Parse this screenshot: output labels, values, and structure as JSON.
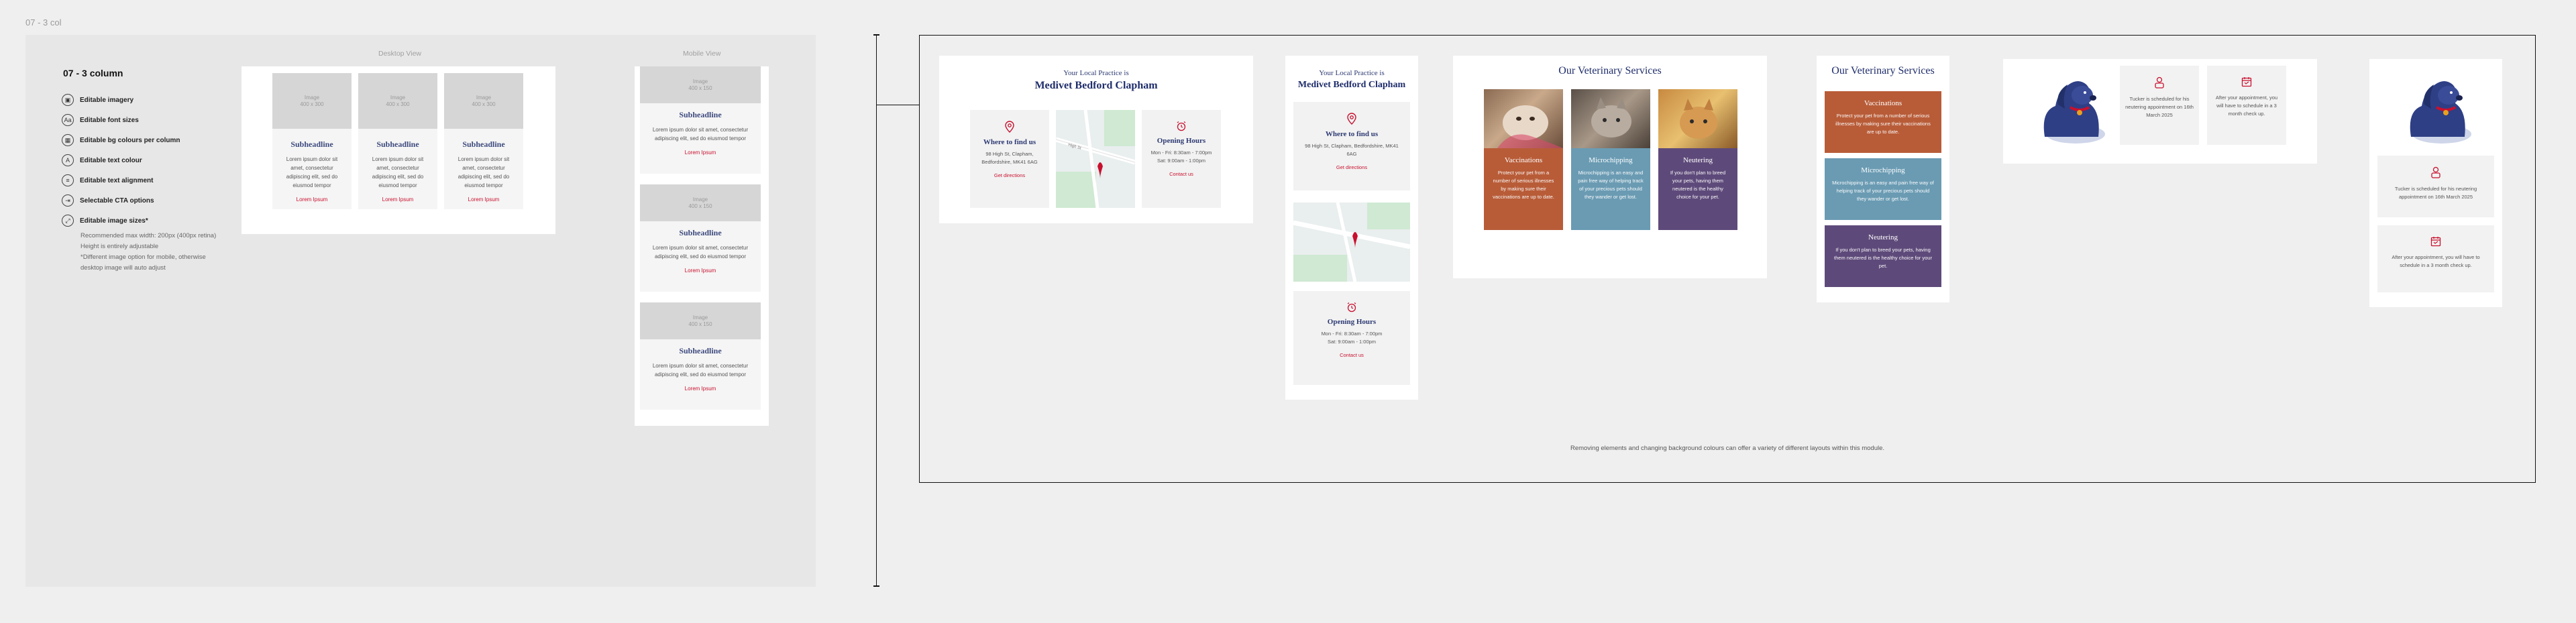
{
  "frame_name": "07 - 3 col",
  "spec": {
    "title": "07 - 3 column",
    "items": [
      {
        "icon": "image-icon",
        "glyph": "▣",
        "label": "Editable imagery"
      },
      {
        "icon": "font-size-icon",
        "glyph": "Aa",
        "label": "Editable font sizes"
      },
      {
        "icon": "bg-colour-icon",
        "glyph": "▦",
        "label": "Editable bg colours per column"
      },
      {
        "icon": "text-colour-icon",
        "glyph": "A",
        "label": "Editable text colour"
      },
      {
        "icon": "text-align-icon",
        "glyph": "≡",
        "label": "Editable text alignment"
      },
      {
        "icon": "cta-icon",
        "glyph": "⇥",
        "label": "Selectable CTA options"
      },
      {
        "icon": "image-size-icon",
        "glyph": "⤢",
        "label": "Editable image sizes*"
      }
    ],
    "notes": [
      "Recommended max width: 200px (400px retina)",
      "Height is entirely adjustable",
      "*Different image option for mobile, otherwise",
      "desktop image will auto adjust"
    ]
  },
  "desktop_view_label": "Desktop View",
  "mobile_view_label": "Mobile View",
  "template_card": {
    "image_label": "Image",
    "image_size": "400 x 300",
    "mobile_image_size": "400 x 150",
    "subheadline": "Subheadline",
    "body": "Lorem ipsum dolor sit amet, consectetur adipiscing elit, sed do eiusmod tempor",
    "cta": "Lorem Ipsum"
  },
  "example_location": {
    "kicker": "Your Local Practice is",
    "name": "Medivet Bedford Clapham",
    "where_title": "Where to find us",
    "address": "98 High St, Clapham, Bedfordshire, MK41 6AG",
    "directions_cta": "Get directions",
    "hours_title": "Opening Hours",
    "hours_line1": "Mon - Fri: 8:30am - 7:00pm",
    "hours_line2": "Sat: 9:00am - 1:00pm",
    "contact_cta": "Contact us",
    "map_street": "High St"
  },
  "example_services": {
    "title": "Our Veterinary Services",
    "columns": [
      {
        "title": "Vaccinations",
        "text": "Protect your pet from a number of serious illnesses by making sure their vaccinations are up to date.",
        "color": "#b85c38"
      },
      {
        "title": "Microchipping",
        "text": "Microchipping is an easy and pain free way of helping track of your precious pets should they wander or get lost.",
        "color": "#6a9bb3"
      },
      {
        "title": "Neutering",
        "text": "If you don't plan to breed your pets, having them neutered is the healthy choice for your pet.",
        "color": "#5e4a7a"
      }
    ]
  },
  "example_reminders": {
    "notes": [
      "Tucker is scheduled for his neutering appointment on 16th March 2025",
      "After your appointment, you will have to schedule in a 3 month check up."
    ]
  },
  "footer_note": "Removing elements and changing background colours can offer a variety of different layouts within this module.",
  "colors": {
    "brand_navy": "#1f2d6b",
    "cta_red": "#c8102e"
  }
}
